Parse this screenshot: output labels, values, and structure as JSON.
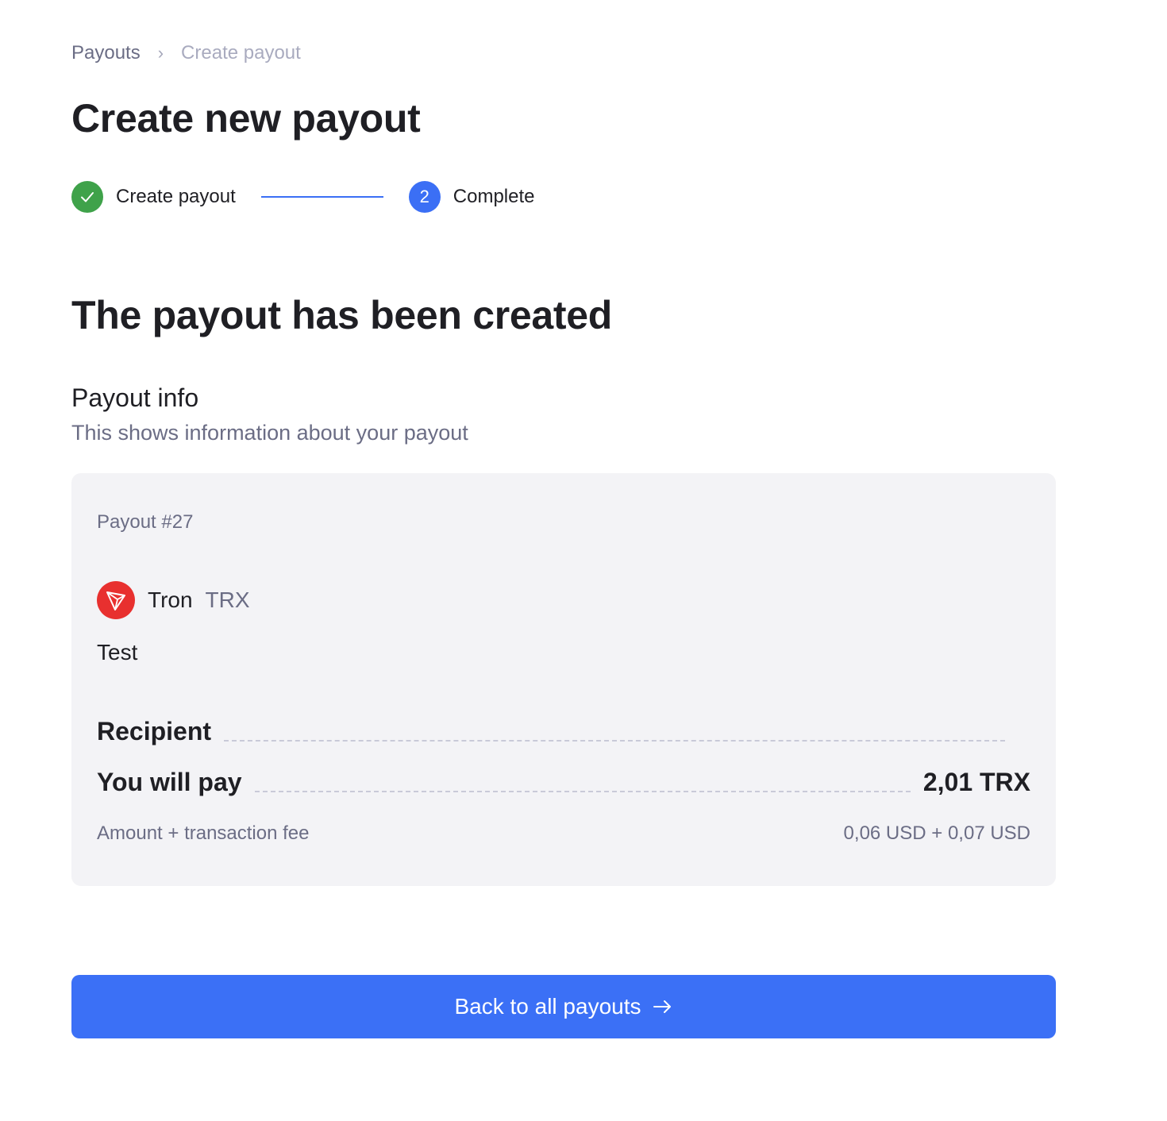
{
  "breadcrumb": {
    "parent": "Payouts",
    "current": "Create payout"
  },
  "page_title": "Create new payout",
  "stepper": {
    "steps": [
      {
        "label": "Create payout",
        "status": "done"
      },
      {
        "label": "Complete",
        "number": "2",
        "status": "active"
      }
    ]
  },
  "success_title": "The payout has been created",
  "payout_info": {
    "title": "Payout info",
    "subtitle": "This shows information about your payout"
  },
  "card": {
    "payout_id": "Payout #27",
    "currency_name": "Tron",
    "currency_code": "TRX",
    "currency_icon": "tron-icon",
    "description": "Test",
    "recipient_label": "Recipient",
    "pay_label": "You will pay",
    "pay_value": "2,01 TRX",
    "fee_label": "Amount + transaction fee",
    "fee_value": "0,06 USD + 0,07 USD"
  },
  "back_button": {
    "label": "Back to all payouts"
  },
  "colors": {
    "accent": "#3b70f6",
    "success": "#3fa24a",
    "tron": "#e8302f",
    "muted_text": "#6b6d85",
    "card_bg": "#f3f3f6"
  }
}
